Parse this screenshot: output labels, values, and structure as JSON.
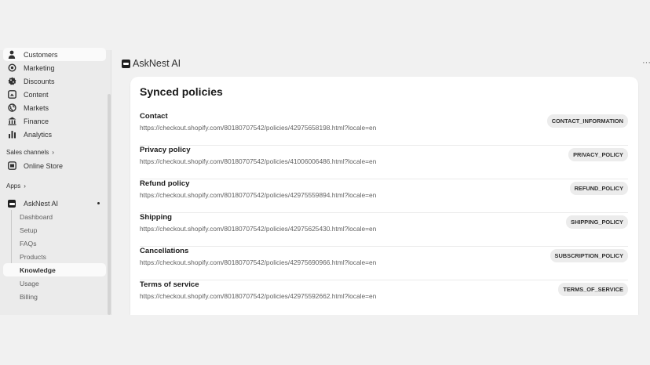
{
  "sidebar": {
    "items": [
      {
        "label": "Customers",
        "icon": "person-icon"
      },
      {
        "label": "Marketing",
        "icon": "target-icon"
      },
      {
        "label": "Discounts",
        "icon": "discount-icon"
      },
      {
        "label": "Content",
        "icon": "content-icon"
      },
      {
        "label": "Markets",
        "icon": "globe-icon"
      },
      {
        "label": "Finance",
        "icon": "bank-icon"
      },
      {
        "label": "Analytics",
        "icon": "chart-icon"
      }
    ],
    "sales_channels_label": "Sales channels",
    "online_store_label": "Online Store",
    "apps_label": "Apps",
    "app_name": "AskNest AI",
    "sub_items": [
      "Dashboard",
      "Setup",
      "FAQs",
      "Products",
      "Knowledge",
      "Usage",
      "Billing"
    ],
    "active_sub_item": "Knowledge"
  },
  "header": {
    "app_title": "AskNest AI",
    "more_label": "···"
  },
  "main": {
    "card_title": "Synced policies",
    "policies": [
      {
        "name": "Contact",
        "url": "https://checkout.shopify.com/80180707542/policies/42975658198.html?locale=en",
        "type": "CONTACT_INFORMATION"
      },
      {
        "name": "Privacy policy",
        "url": "https://checkout.shopify.com/80180707542/policies/41006006486.html?locale=en",
        "type": "PRIVACY_POLICY"
      },
      {
        "name": "Refund policy",
        "url": "https://checkout.shopify.com/80180707542/policies/42975559894.html?locale=en",
        "type": "REFUND_POLICY"
      },
      {
        "name": "Shipping",
        "url": "https://checkout.shopify.com/80180707542/policies/42975625430.html?locale=en",
        "type": "SHIPPING_POLICY"
      },
      {
        "name": "Cancellations",
        "url": "https://checkout.shopify.com/80180707542/policies/42975690966.html?locale=en",
        "type": "SUBSCRIPTION_POLICY"
      },
      {
        "name": "Terms of service",
        "url": "https://checkout.shopify.com/80180707542/policies/42975592662.html?locale=en",
        "type": "TERMS_OF_SERVICE"
      }
    ]
  }
}
